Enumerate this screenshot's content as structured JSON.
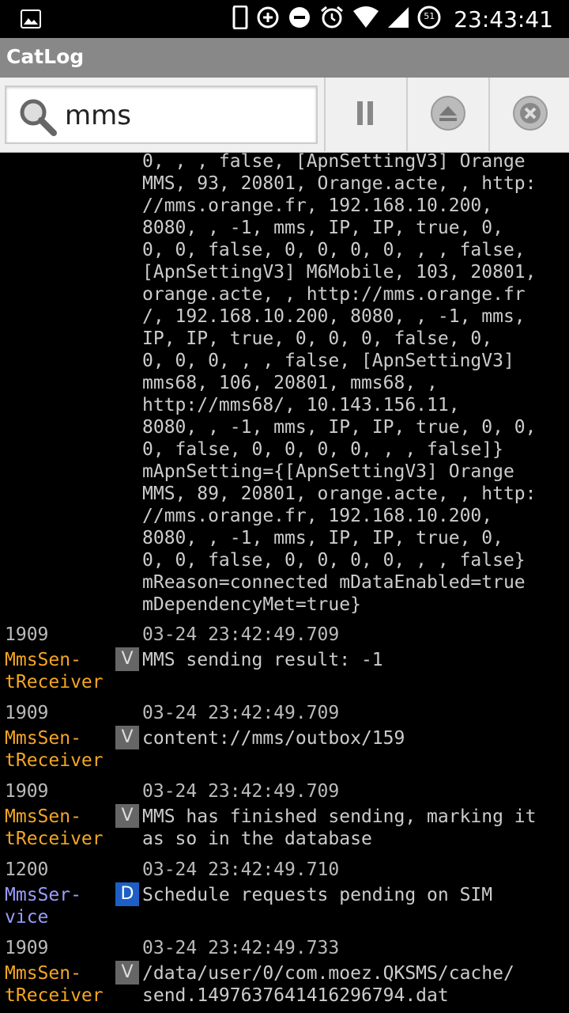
{
  "status_bar": {
    "time": "23:43:41",
    "icons": [
      "image-icon",
      "phone-icon",
      "data-saver-icon",
      "do-not-disturb-icon",
      "alarm-icon",
      "wifi-icon",
      "signal-icon",
      "battery-icon"
    ],
    "battery_label": "51"
  },
  "app": {
    "title": "CatLog"
  },
  "toolbar": {
    "search_value": "mms",
    "buttons": [
      "pause-icon",
      "scroll-top-icon",
      "clear-icon"
    ]
  },
  "log": {
    "continuation_text": "0, , , false, [ApnSettingV3] Orange\nMMS, 93, 20801, Orange.acte, , http:\n//mms.orange.fr, 192.168.10.200,\n8080, , -1, mms, IP, IP, true, 0,\n0, 0, false, 0, 0, 0, 0, , , false,\n[ApnSettingV3] M6Mobile, 103, 20801,\norange.acte, , http://mms.orange.fr\n/, 192.168.10.200, 8080, , -1, mms,\nIP, IP, true, 0, 0, 0, false, 0,\n0, 0, 0, , , false, [ApnSettingV3]\nmms68, 106, 20801, mms68, ,\nhttp://mms68/, 10.143.156.11,\n8080, , -1, mms, IP, IP, true, 0, 0,\n0, false, 0, 0, 0, 0, , , false]}\nmApnSetting={[ApnSettingV3] Orange\nMMS, 89, 20801, orange.acte, , http:\n//mms.orange.fr, 192.168.10.200,\n8080, , -1, mms, IP, IP, true, 0,\n0, 0, false, 0, 0, 0, 0, , , false}\nmReason=connected mDataEnabled=true\nmDependencyMet=true}",
    "entries": [
      {
        "pid": "1909",
        "timestamp": "03-24 23:42:49.709",
        "tag": "MmsSen-\ntReceiver",
        "level": "V",
        "message": "MMS sending result: -1"
      },
      {
        "pid": "1909",
        "timestamp": "03-24 23:42:49.709",
        "tag": "MmsSen-\ntReceiver",
        "level": "V",
        "message": "content://mms/outbox/159"
      },
      {
        "pid": "1909",
        "timestamp": "03-24 23:42:49.709",
        "tag": "MmsSen-\ntReceiver",
        "level": "V",
        "message": "MMS has finished sending, marking it\nas so in the database"
      },
      {
        "pid": "1200",
        "timestamp": "03-24 23:42:49.710",
        "tag": "MmsSer-\nvice",
        "level": "D",
        "message": "Schedule requests pending on SIM"
      },
      {
        "pid": "1909",
        "timestamp": "03-24 23:42:49.733",
        "tag": "MmsSen-\ntReceiver",
        "level": "V",
        "message": "/data/user/0/com.moez.QKSMS/cache/\nsend.1497637641416296794.dat"
      }
    ]
  }
}
